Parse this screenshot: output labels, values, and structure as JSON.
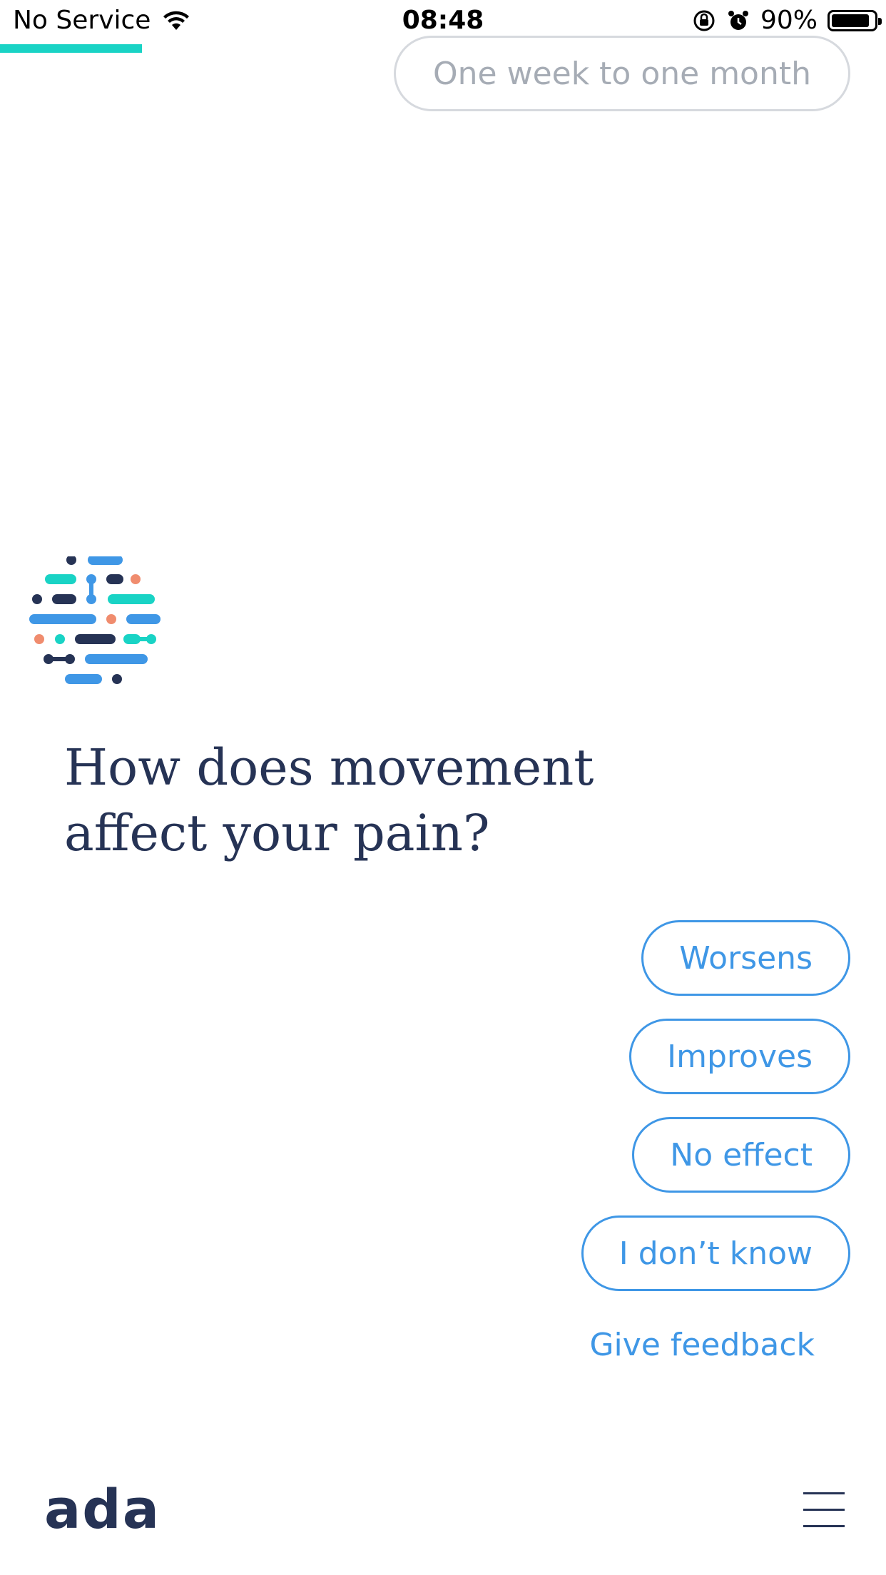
{
  "status_bar": {
    "carrier": "No Service",
    "time": "08:48",
    "battery_percent": "90%",
    "battery_level": 0.9,
    "icons": [
      "wifi-icon",
      "orientation-lock-icon",
      "alarm-icon",
      "battery-icon"
    ]
  },
  "progress": {
    "fraction": 0.16,
    "color": "#19d3c5"
  },
  "previous_answer": "One week to one month",
  "question": {
    "line1": "How does movement",
    "line2": "affect your pain?"
  },
  "options": [
    {
      "label": "Worsens"
    },
    {
      "label": "Improves"
    },
    {
      "label": "No effect"
    },
    {
      "label": "I don’t know"
    }
  ],
  "feedback_link": "Give feedback",
  "footer": {
    "brand": "ada",
    "menu_icon": "hamburger-menu-icon"
  },
  "colors": {
    "accent": "#3f97e6",
    "navy": "#263355",
    "teal": "#19d3c5",
    "coral": "#f08c6e",
    "muted": "#a6acb5"
  }
}
